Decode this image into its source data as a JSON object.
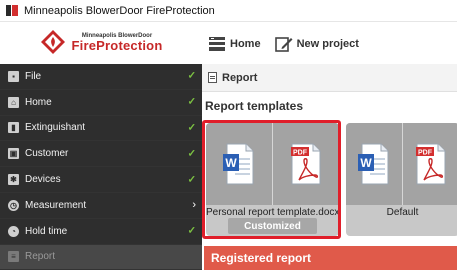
{
  "window": {
    "title": "Minneapolis BlowerDoor FireProtection"
  },
  "logo": {
    "small_text": "Minneapolis BlowerDoor",
    "brand_text": "FireProtection"
  },
  "toolbar": {
    "home_label": "Home",
    "new_project_label": "New project"
  },
  "sidebar": {
    "items": [
      {
        "label": "File",
        "icon": "file-icon",
        "status": "done"
      },
      {
        "label": "Home",
        "icon": "home-icon",
        "status": "done"
      },
      {
        "label": "Extinguishant",
        "icon": "extinguisher-icon",
        "status": "done"
      },
      {
        "label": "Customer",
        "icon": "customer-icon",
        "status": "done"
      },
      {
        "label": "Devices",
        "icon": "devices-icon",
        "status": "done"
      },
      {
        "label": "Measurement",
        "icon": "measurement-icon",
        "status": "arrow"
      },
      {
        "label": "Hold time",
        "icon": "hold-time-icon",
        "status": "done"
      },
      {
        "label": "Report",
        "icon": "report-icon",
        "status": "active"
      }
    ]
  },
  "main": {
    "header": "Report",
    "templates_title": "Report templates",
    "templates": [
      {
        "name": "Personal report template.docx",
        "badge": "Customized",
        "selected": true
      },
      {
        "name": "Default",
        "badge": "",
        "selected": false
      }
    ],
    "registered_title": "Registered report"
  },
  "colors": {
    "accent_red": "#e01e2a",
    "registered_bar": "#e05a4a",
    "sidebar_bg": "#2e2e2e",
    "check_green": "#7cc242"
  }
}
